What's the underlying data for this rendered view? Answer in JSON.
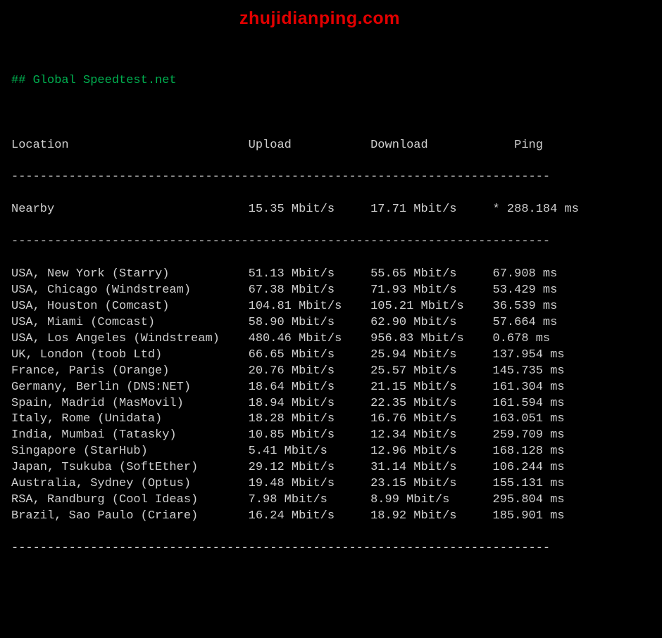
{
  "title": "## Global Speedtest.net",
  "watermark": "zhujidianping.com",
  "divider": "---------------------------------------------------------------------------",
  "headers": {
    "location": "Location",
    "upload": "Upload",
    "download": "Download",
    "ping": "Ping"
  },
  "nearby": {
    "location": "Nearby",
    "upload": "15.35 Mbit/s",
    "download": "17.71 Mbit/s",
    "ping": "* 288.184 ms"
  },
  "rows": [
    {
      "location": "USA, New York (Starry)",
      "upload": "51.13 Mbit/s",
      "download": "55.65 Mbit/s",
      "ping": "67.908 ms"
    },
    {
      "location": "USA, Chicago (Windstream)",
      "upload": "67.38 Mbit/s",
      "download": "71.93 Mbit/s",
      "ping": "53.429 ms"
    },
    {
      "location": "USA, Houston (Comcast)",
      "upload": "104.81 Mbit/s",
      "download": "105.21 Mbit/s",
      "ping": "36.539 ms"
    },
    {
      "location": "USA, Miami (Comcast)",
      "upload": "58.90 Mbit/s",
      "download": "62.90 Mbit/s",
      "ping": "57.664 ms"
    },
    {
      "location": "USA, Los Angeles (Windstream)",
      "upload": "480.46 Mbit/s",
      "download": "956.83 Mbit/s",
      "ping": "0.678 ms"
    },
    {
      "location": "UK, London (toob Ltd)",
      "upload": "66.65 Mbit/s",
      "download": "25.94 Mbit/s",
      "ping": "137.954 ms"
    },
    {
      "location": "France, Paris (Orange)",
      "upload": "20.76 Mbit/s",
      "download": "25.57 Mbit/s",
      "ping": "145.735 ms"
    },
    {
      "location": "Germany, Berlin (DNS:NET)",
      "upload": "18.64 Mbit/s",
      "download": "21.15 Mbit/s",
      "ping": "161.304 ms"
    },
    {
      "location": "Spain, Madrid (MasMovil)",
      "upload": "18.94 Mbit/s",
      "download": "22.35 Mbit/s",
      "ping": "161.594 ms"
    },
    {
      "location": "Italy, Rome (Unidata)",
      "upload": "18.28 Mbit/s",
      "download": "16.76 Mbit/s",
      "ping": "163.051 ms"
    },
    {
      "location": "India, Mumbai (Tatasky)",
      "upload": "10.85 Mbit/s",
      "download": "12.34 Mbit/s",
      "ping": "259.709 ms"
    },
    {
      "location": "Singapore (StarHub)",
      "upload": "5.41 Mbit/s",
      "download": "12.96 Mbit/s",
      "ping": "168.128 ms"
    },
    {
      "location": "Japan, Tsukuba (SoftEther)",
      "upload": "29.12 Mbit/s",
      "download": "31.14 Mbit/s",
      "ping": "106.244 ms"
    },
    {
      "location": "Australia, Sydney (Optus)",
      "upload": "19.48 Mbit/s",
      "download": "23.15 Mbit/s",
      "ping": "155.131 ms"
    },
    {
      "location": "RSA, Randburg (Cool Ideas)",
      "upload": "7.98 Mbit/s",
      "download": "8.99 Mbit/s",
      "ping": "295.804 ms"
    },
    {
      "location": "Brazil, Sao Paulo (Criare)",
      "upload": "16.24 Mbit/s",
      "download": "18.92 Mbit/s",
      "ping": "185.901 ms"
    }
  ]
}
